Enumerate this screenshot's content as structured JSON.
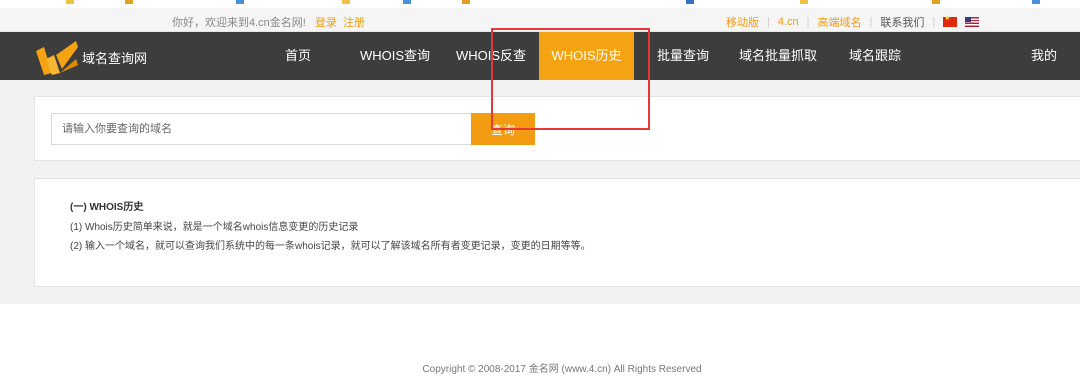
{
  "utility_bar": {
    "greeting": "你好，欢迎来到4.cn金名网!",
    "login": "登录",
    "register": "注册",
    "links": [
      "移动版",
      "4.cn",
      "高端域名",
      "联系我们"
    ]
  },
  "navbar": {
    "site_name": "域名查询网",
    "items": [
      "首页",
      "WHOIS查询",
      "WHOIS反查",
      "WHOIS历史",
      "批量查询",
      "域名批量抓取",
      "域名跟踪",
      "我的"
    ],
    "active_index": 3
  },
  "search": {
    "placeholder": "请输入你要查询的域名",
    "button": "查询"
  },
  "info": {
    "title": "(一) WHOIS历史",
    "lines": [
      "(1) Whois历史简单来说，就是一个域名whois信息变更的历史记录",
      "(2) 输入一个域名，就可以查询我们系统中的每一条whois记录，就可以了解该域名所有者变更记录，变更的日期等等。"
    ]
  },
  "footer": {
    "copyright": "Copyright © 2008-2017 金名网 (www.4.cn) All Rights Reserved"
  },
  "colors": {
    "accent": "#f5a213",
    "nav_bg": "#3d3d3d",
    "highlight": "#e53935"
  }
}
